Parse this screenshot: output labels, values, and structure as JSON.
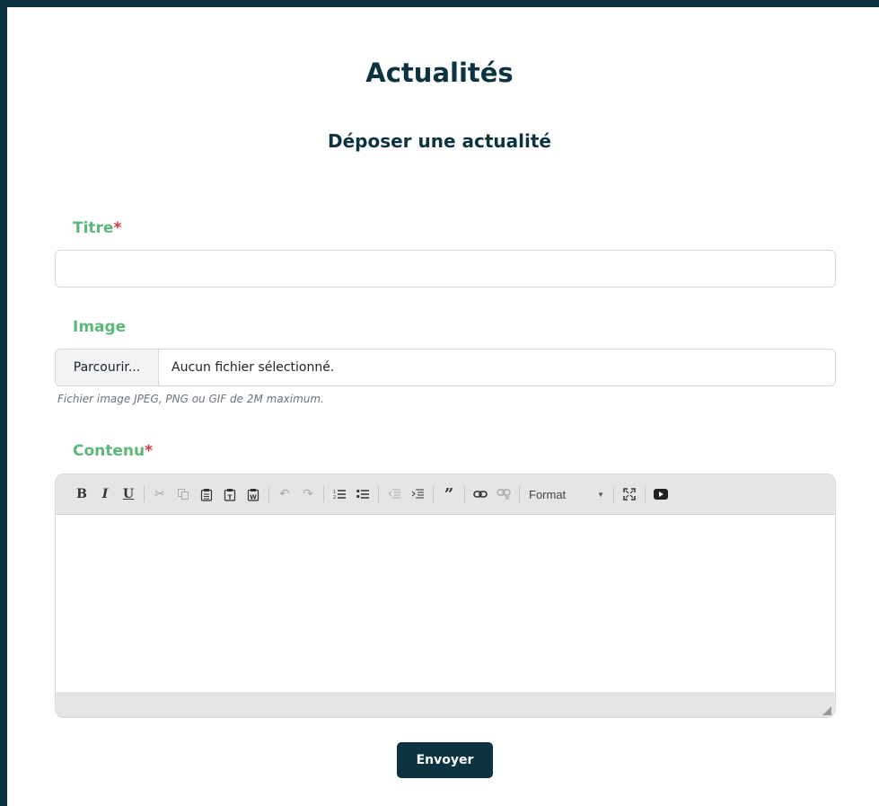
{
  "page": {
    "title": "Actualités",
    "subtitle": "Déposer une actualité"
  },
  "form": {
    "title_label": "Titre",
    "required_mark": "*",
    "title_value": "",
    "image_label": "Image",
    "file_button": "Parcourir...",
    "file_status": "Aucun fichier sélectionné.",
    "file_hint": "Fichier image JPEG, PNG ou GIF de 2M maximum.",
    "content_label": "Contenu",
    "submit_label": "Envoyer"
  },
  "editor": {
    "format_label": "Format",
    "toolbar_groups": [
      [
        {
          "name": "bold-icon",
          "glyph": "B",
          "disabled": false
        },
        {
          "name": "italic-icon",
          "glyph": "I",
          "disabled": false
        },
        {
          "name": "underline-icon",
          "glyph": "U",
          "disabled": false
        }
      ],
      [
        {
          "name": "cut-icon",
          "glyph": "✂",
          "disabled": true
        },
        {
          "name": "copy-icon",
          "glyph": "⎘",
          "disabled": true
        },
        {
          "name": "paste-icon",
          "glyph": "📋",
          "disabled": false
        },
        {
          "name": "paste-text-icon",
          "glyph": "📋",
          "disabled": false
        },
        {
          "name": "paste-word-icon",
          "glyph": "📋",
          "disabled": false
        }
      ],
      [
        {
          "name": "undo-icon",
          "glyph": "↶",
          "disabled": true
        },
        {
          "name": "redo-icon",
          "glyph": "↷",
          "disabled": true
        }
      ],
      [
        {
          "name": "numbered-list-icon",
          "glyph": "⒈",
          "disabled": false
        },
        {
          "name": "bulleted-list-icon",
          "glyph": "☰",
          "disabled": false
        }
      ],
      [
        {
          "name": "outdent-icon",
          "glyph": "⇤",
          "disabled": true
        },
        {
          "name": "indent-icon",
          "glyph": "⇥",
          "disabled": false
        }
      ],
      [
        {
          "name": "blockquote-icon",
          "glyph": "❞",
          "disabled": false
        }
      ],
      [
        {
          "name": "link-icon",
          "glyph": "∞",
          "disabled": false
        },
        {
          "name": "unlink-icon",
          "glyph": "∞",
          "disabled": true
        }
      ]
    ],
    "trailing_icons": [
      "maximize-icon",
      "youtube-icon"
    ]
  },
  "colors": {
    "brand_dark": "#0b3340",
    "label_green": "#5cb87a",
    "required_red": "#dc3545"
  }
}
